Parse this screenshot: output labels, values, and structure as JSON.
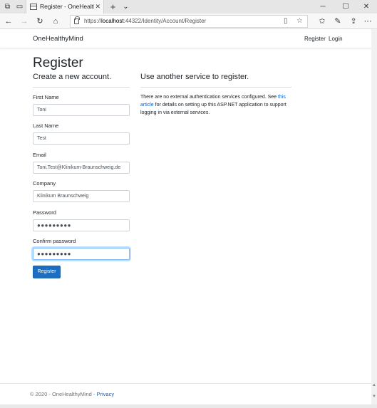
{
  "browser": {
    "tab_title": "Register - OneHealthyMind",
    "url_prefix": "https://",
    "url_host": "localhost",
    "url_path": ":44322/Identity/Account/Register",
    "icons": {
      "tab_manager": "tab-manager-icon",
      "tab_preview": "tab-preview-icon",
      "new_tab": "plus-icon",
      "tab_list": "chevron-down-icon",
      "minimize": "minimize-icon",
      "maximize": "maximize-icon",
      "close": "close-icon",
      "back": "back-arrow-icon",
      "forward": "forward-arrow-icon",
      "refresh": "refresh-icon",
      "home": "home-icon",
      "lock": "lock-icon",
      "reading_view": "reading-view-icon",
      "favorite": "star-icon",
      "favorites_hub": "favorites-hub-icon",
      "notes": "pen-icon",
      "share": "share-icon",
      "more": "more-icon"
    }
  },
  "site": {
    "brand": "OneHealthyMind",
    "nav": {
      "register": "Register",
      "login": "Login"
    }
  },
  "page": {
    "title": "Register",
    "subtitle": "Create a new account.",
    "ext_heading": "Use another service to register.",
    "ext_text_before": "There are no external authentication services configured. See ",
    "ext_link": "this article",
    "ext_text_after": " for details on setting up this ASP.NET application to support logging in via external services."
  },
  "form": {
    "first_name": {
      "label": "First Name",
      "value": "Toni"
    },
    "last_name": {
      "label": "Last Name",
      "value": "Test"
    },
    "email": {
      "label": "Email",
      "value": "Toni.Test@Klinikum-Braunschweig.de"
    },
    "company": {
      "label": "Company",
      "value": "Klinikum Braunschweig"
    },
    "password": {
      "label": "Password",
      "value": "●●●●●●●●●"
    },
    "confirm_password": {
      "label": "Confirm password",
      "value": "●●●●●●●●●"
    },
    "submit": "Register"
  },
  "footer": {
    "copyright": "© 2020 - OneHealthyMind - ",
    "privacy": "Privacy"
  },
  "colors": {
    "accent": "#1b6ec2",
    "link": "#0366d6"
  }
}
